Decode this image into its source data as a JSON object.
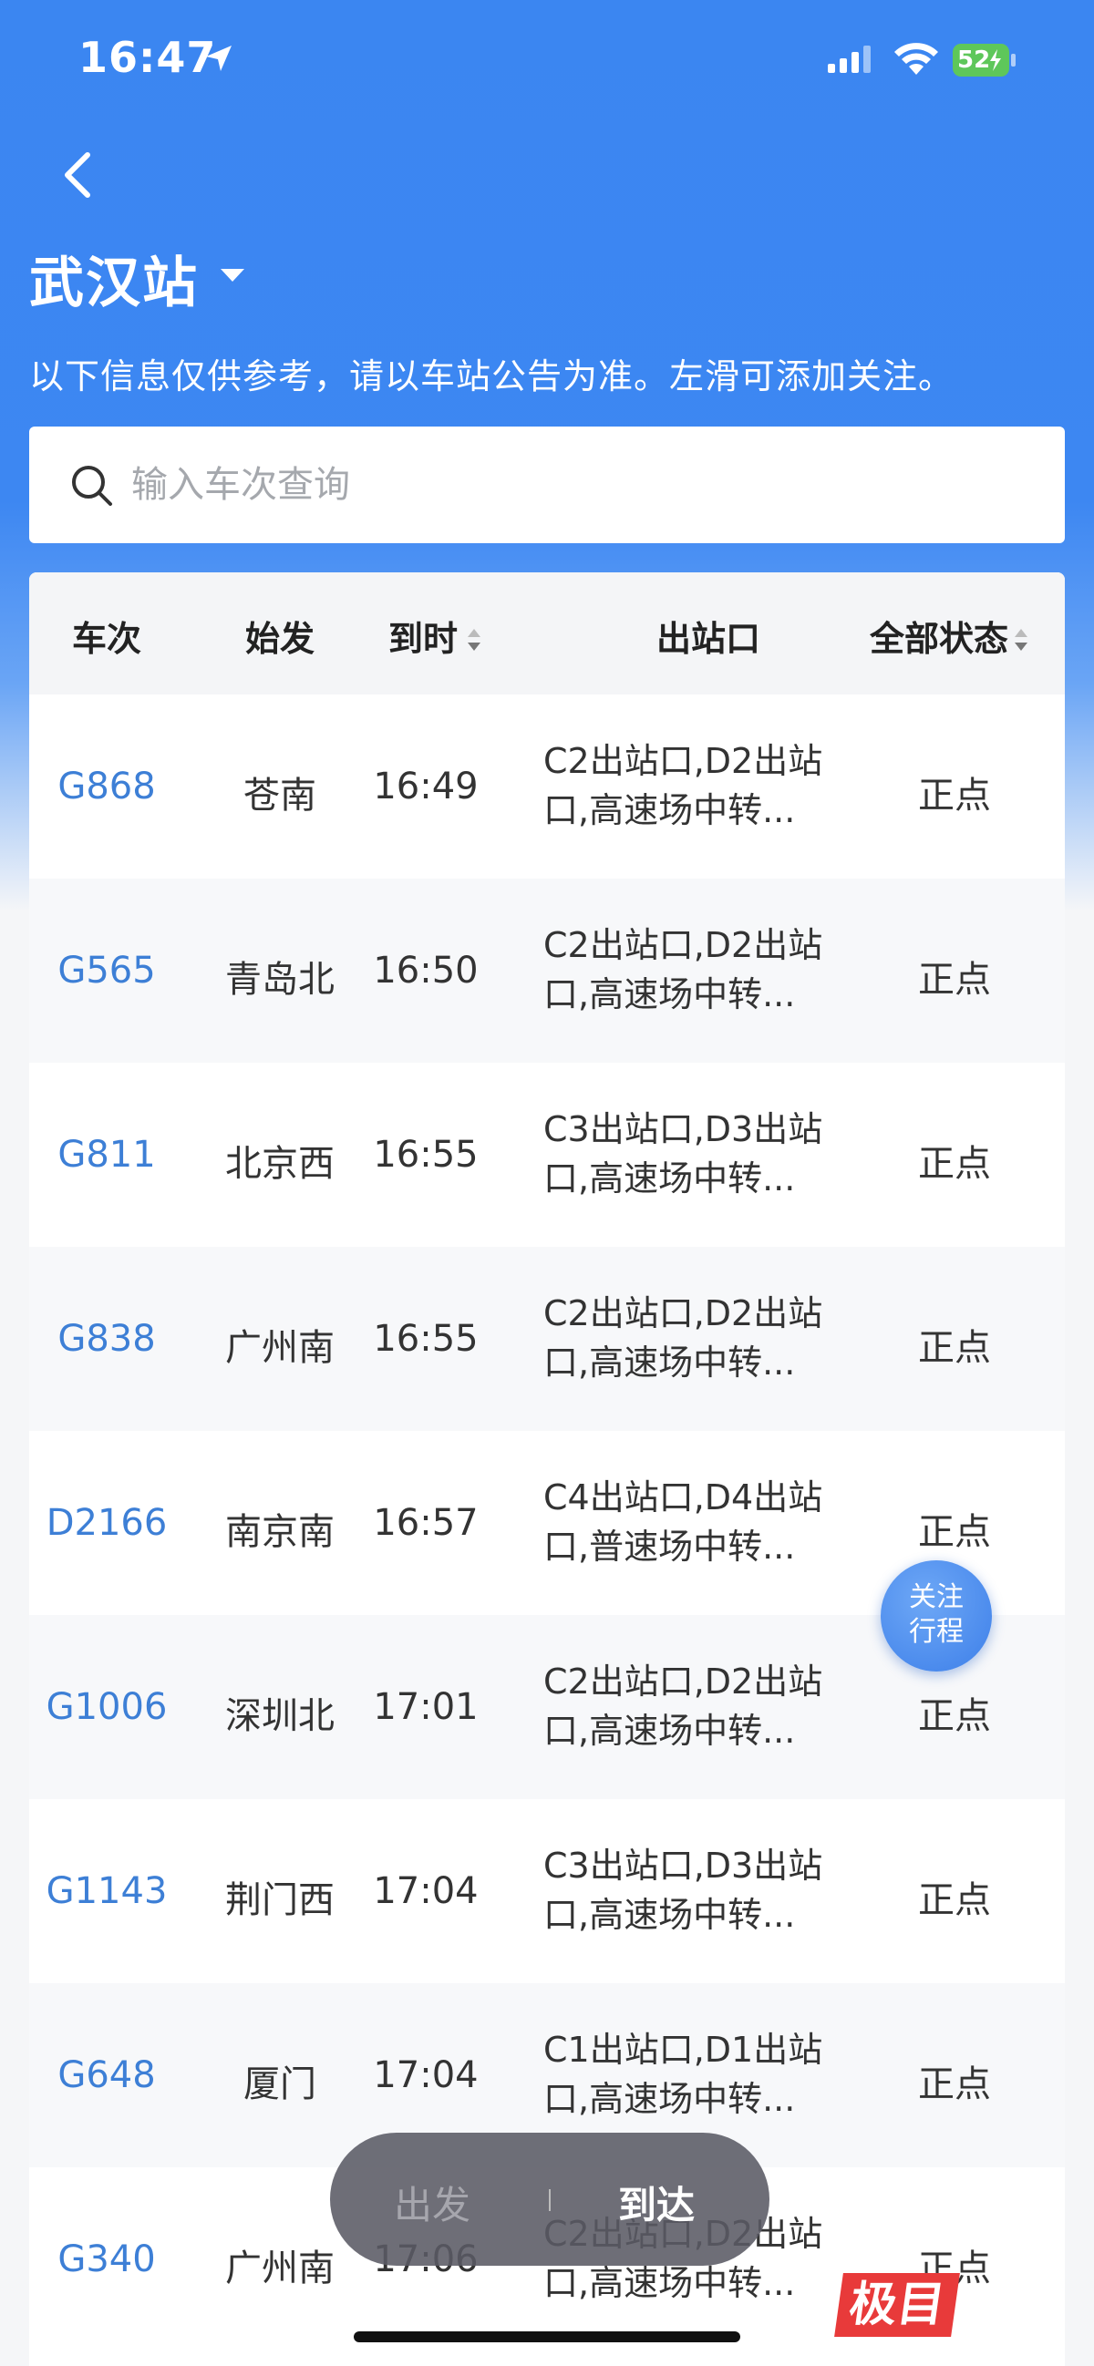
{
  "status_bar": {
    "time": "16:47",
    "battery": "52"
  },
  "header": {
    "station": "武汉站",
    "notice": "以下信息仅供参考，请以车站公告为准。左滑可添加关注。"
  },
  "search": {
    "placeholder": "输入车次查询"
  },
  "table": {
    "columns": [
      "车次",
      "始发",
      "到时",
      "出站口",
      "全部状态"
    ],
    "rows": [
      {
        "train": "G868",
        "origin": "苍南",
        "arrive": "16:49",
        "exit_line1": "C2出站口,D2出站",
        "exit_line2": "口,高速场中转...",
        "status": "正点"
      },
      {
        "train": "G565",
        "origin": "青岛北",
        "arrive": "16:50",
        "exit_line1": "C2出站口,D2出站",
        "exit_line2": "口,高速场中转...",
        "status": "正点"
      },
      {
        "train": "G811",
        "origin": "北京西",
        "arrive": "16:55",
        "exit_line1": "C3出站口,D3出站",
        "exit_line2": "口,高速场中转...",
        "status": "正点"
      },
      {
        "train": "G838",
        "origin": "广州南",
        "arrive": "16:55",
        "exit_line1": "C2出站口,D2出站",
        "exit_line2": "口,高速场中转...",
        "status": "正点"
      },
      {
        "train": "D2166",
        "origin": "南京南",
        "arrive": "16:57",
        "exit_line1": "C4出站口,D4出站",
        "exit_line2": "口,普速场中转...",
        "status": "正点"
      },
      {
        "train": "G1006",
        "origin": "深圳北",
        "arrive": "17:01",
        "exit_line1": "C2出站口,D2出站",
        "exit_line2": "口,高速场中转...",
        "status": "正点"
      },
      {
        "train": "G1143",
        "origin": "荆门西",
        "arrive": "17:04",
        "exit_line1": "C3出站口,D3出站",
        "exit_line2": "口,高速场中转...",
        "status": "正点"
      },
      {
        "train": "G648",
        "origin": "厦门",
        "arrive": "17:04",
        "exit_line1": "C1出站口,D1出站",
        "exit_line2": "口,高速场中转...",
        "status": "正点"
      },
      {
        "train": "G340",
        "origin": "广州南",
        "arrive": "17:06",
        "exit_line1": "C2出站口,D2出站",
        "exit_line2": "口,高速场中转...",
        "status": "正点"
      }
    ]
  },
  "follow_button": {
    "line1": "关注",
    "line2": "行程"
  },
  "toggle": {
    "depart": "出发",
    "arrive": "到达"
  },
  "watermark": "极目",
  "colors": {
    "header_blue": "#3b86f1",
    "train_link": "#3d7fd6"
  }
}
